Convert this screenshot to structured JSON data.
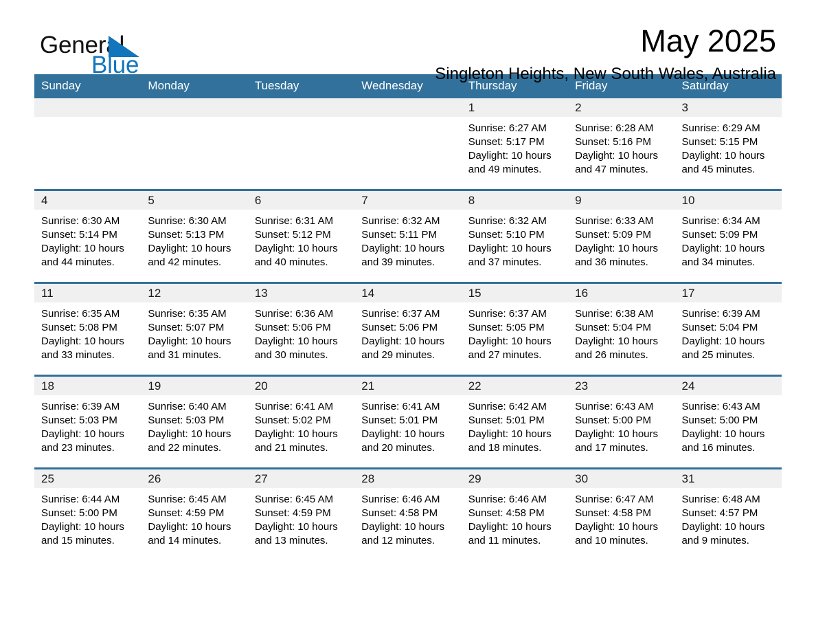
{
  "brand": {
    "name_part1": "General",
    "name_part2": "Blue",
    "logo_mark": "triangle-mark",
    "accent_color": "#1376bc"
  },
  "header": {
    "month_title": "May 2025",
    "location": "Singleton Heights, New South Wales, Australia"
  },
  "theme": {
    "header_band": "#31719b",
    "daynum_band": "#f0f0f0",
    "text": "#000000"
  },
  "weekdays": [
    "Sunday",
    "Monday",
    "Tuesday",
    "Wednesday",
    "Thursday",
    "Friday",
    "Saturday"
  ],
  "weeks": [
    [
      {
        "day": "",
        "empty": true
      },
      {
        "day": "",
        "empty": true
      },
      {
        "day": "",
        "empty": true
      },
      {
        "day": "",
        "empty": true
      },
      {
        "day": "1",
        "sunrise": "Sunrise: 6:27 AM",
        "sunset": "Sunset: 5:17 PM",
        "daylight": "Daylight: 10 hours and 49 minutes."
      },
      {
        "day": "2",
        "sunrise": "Sunrise: 6:28 AM",
        "sunset": "Sunset: 5:16 PM",
        "daylight": "Daylight: 10 hours and 47 minutes."
      },
      {
        "day": "3",
        "sunrise": "Sunrise: 6:29 AM",
        "sunset": "Sunset: 5:15 PM",
        "daylight": "Daylight: 10 hours and 45 minutes."
      }
    ],
    [
      {
        "day": "4",
        "sunrise": "Sunrise: 6:30 AM",
        "sunset": "Sunset: 5:14 PM",
        "daylight": "Daylight: 10 hours and 44 minutes."
      },
      {
        "day": "5",
        "sunrise": "Sunrise: 6:30 AM",
        "sunset": "Sunset: 5:13 PM",
        "daylight": "Daylight: 10 hours and 42 minutes."
      },
      {
        "day": "6",
        "sunrise": "Sunrise: 6:31 AM",
        "sunset": "Sunset: 5:12 PM",
        "daylight": "Daylight: 10 hours and 40 minutes."
      },
      {
        "day": "7",
        "sunrise": "Sunrise: 6:32 AM",
        "sunset": "Sunset: 5:11 PM",
        "daylight": "Daylight: 10 hours and 39 minutes."
      },
      {
        "day": "8",
        "sunrise": "Sunrise: 6:32 AM",
        "sunset": "Sunset: 5:10 PM",
        "daylight": "Daylight: 10 hours and 37 minutes."
      },
      {
        "day": "9",
        "sunrise": "Sunrise: 6:33 AM",
        "sunset": "Sunset: 5:09 PM",
        "daylight": "Daylight: 10 hours and 36 minutes."
      },
      {
        "day": "10",
        "sunrise": "Sunrise: 6:34 AM",
        "sunset": "Sunset: 5:09 PM",
        "daylight": "Daylight: 10 hours and 34 minutes."
      }
    ],
    [
      {
        "day": "11",
        "sunrise": "Sunrise: 6:35 AM",
        "sunset": "Sunset: 5:08 PM",
        "daylight": "Daylight: 10 hours and 33 minutes."
      },
      {
        "day": "12",
        "sunrise": "Sunrise: 6:35 AM",
        "sunset": "Sunset: 5:07 PM",
        "daylight": "Daylight: 10 hours and 31 minutes."
      },
      {
        "day": "13",
        "sunrise": "Sunrise: 6:36 AM",
        "sunset": "Sunset: 5:06 PM",
        "daylight": "Daylight: 10 hours and 30 minutes."
      },
      {
        "day": "14",
        "sunrise": "Sunrise: 6:37 AM",
        "sunset": "Sunset: 5:06 PM",
        "daylight": "Daylight: 10 hours and 29 minutes."
      },
      {
        "day": "15",
        "sunrise": "Sunrise: 6:37 AM",
        "sunset": "Sunset: 5:05 PM",
        "daylight": "Daylight: 10 hours and 27 minutes."
      },
      {
        "day": "16",
        "sunrise": "Sunrise: 6:38 AM",
        "sunset": "Sunset: 5:04 PM",
        "daylight": "Daylight: 10 hours and 26 minutes."
      },
      {
        "day": "17",
        "sunrise": "Sunrise: 6:39 AM",
        "sunset": "Sunset: 5:04 PM",
        "daylight": "Daylight: 10 hours and 25 minutes."
      }
    ],
    [
      {
        "day": "18",
        "sunrise": "Sunrise: 6:39 AM",
        "sunset": "Sunset: 5:03 PM",
        "daylight": "Daylight: 10 hours and 23 minutes."
      },
      {
        "day": "19",
        "sunrise": "Sunrise: 6:40 AM",
        "sunset": "Sunset: 5:03 PM",
        "daylight": "Daylight: 10 hours and 22 minutes."
      },
      {
        "day": "20",
        "sunrise": "Sunrise: 6:41 AM",
        "sunset": "Sunset: 5:02 PM",
        "daylight": "Daylight: 10 hours and 21 minutes."
      },
      {
        "day": "21",
        "sunrise": "Sunrise: 6:41 AM",
        "sunset": "Sunset: 5:01 PM",
        "daylight": "Daylight: 10 hours and 20 minutes."
      },
      {
        "day": "22",
        "sunrise": "Sunrise: 6:42 AM",
        "sunset": "Sunset: 5:01 PM",
        "daylight": "Daylight: 10 hours and 18 minutes."
      },
      {
        "day": "23",
        "sunrise": "Sunrise: 6:43 AM",
        "sunset": "Sunset: 5:00 PM",
        "daylight": "Daylight: 10 hours and 17 minutes."
      },
      {
        "day": "24",
        "sunrise": "Sunrise: 6:43 AM",
        "sunset": "Sunset: 5:00 PM",
        "daylight": "Daylight: 10 hours and 16 minutes."
      }
    ],
    [
      {
        "day": "25",
        "sunrise": "Sunrise: 6:44 AM",
        "sunset": "Sunset: 5:00 PM",
        "daylight": "Daylight: 10 hours and 15 minutes."
      },
      {
        "day": "26",
        "sunrise": "Sunrise: 6:45 AM",
        "sunset": "Sunset: 4:59 PM",
        "daylight": "Daylight: 10 hours and 14 minutes."
      },
      {
        "day": "27",
        "sunrise": "Sunrise: 6:45 AM",
        "sunset": "Sunset: 4:59 PM",
        "daylight": "Daylight: 10 hours and 13 minutes."
      },
      {
        "day": "28",
        "sunrise": "Sunrise: 6:46 AM",
        "sunset": "Sunset: 4:58 PM",
        "daylight": "Daylight: 10 hours and 12 minutes."
      },
      {
        "day": "29",
        "sunrise": "Sunrise: 6:46 AM",
        "sunset": "Sunset: 4:58 PM",
        "daylight": "Daylight: 10 hours and 11 minutes."
      },
      {
        "day": "30",
        "sunrise": "Sunrise: 6:47 AM",
        "sunset": "Sunset: 4:58 PM",
        "daylight": "Daylight: 10 hours and 10 minutes."
      },
      {
        "day": "31",
        "sunrise": "Sunrise: 6:48 AM",
        "sunset": "Sunset: 4:57 PM",
        "daylight": "Daylight: 10 hours and 9 minutes."
      }
    ]
  ]
}
